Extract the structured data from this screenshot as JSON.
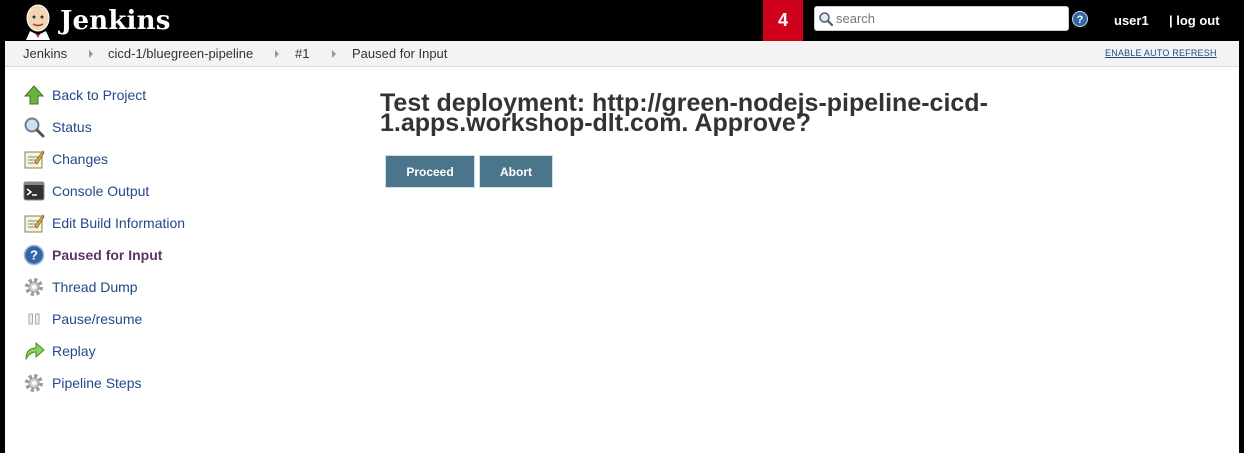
{
  "header": {
    "app_name": "Jenkins",
    "queue_count": "4",
    "search_placeholder": "search",
    "user": "user1",
    "logout": "| log out"
  },
  "breadcrumbs": [
    "Jenkins",
    "cicd-1/bluegreen-pipeline",
    "#1",
    "Paused for Input"
  ],
  "auto_refresh": "ENABLE AUTO REFRESH",
  "side_tasks": [
    {
      "label": "Back to Project",
      "icon": "up-arrow-icon"
    },
    {
      "label": "Status",
      "icon": "magnifier-icon"
    },
    {
      "label": "Changes",
      "icon": "notepad-icon"
    },
    {
      "label": "Console Output",
      "icon": "terminal-icon"
    },
    {
      "label": "Edit Build Information",
      "icon": "notepad-icon"
    },
    {
      "label": "Paused for Input",
      "icon": "help-icon"
    },
    {
      "label": "Thread Dump",
      "icon": "gear-icon"
    },
    {
      "label": "Pause/resume",
      "icon": "pause-icon"
    },
    {
      "label": "Replay",
      "icon": "replay-arrow-icon"
    },
    {
      "label": "Pipeline Steps",
      "icon": "gear-icon"
    }
  ],
  "main": {
    "title": "Test deployment: http://green-nodejs-pipeline-cicd-1.apps.workshop-dlt.com. Approve?",
    "proceed": "Proceed",
    "abort": "Abort"
  },
  "colors": {
    "header_bg": "#000000",
    "badge_bg": "#d0021b",
    "button_bg": "#4b758b",
    "link": "#204a87"
  }
}
